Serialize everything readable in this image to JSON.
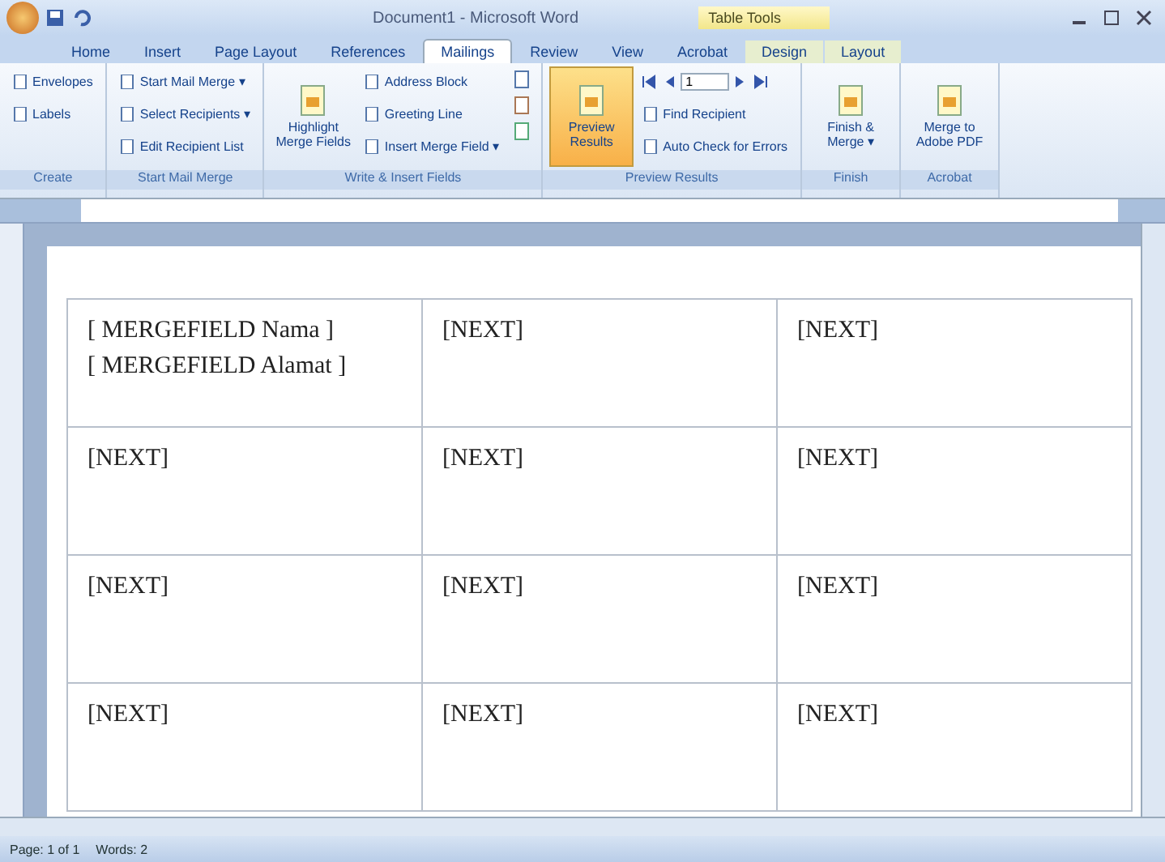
{
  "window": {
    "title": "Document1 - Microsoft Word",
    "contextual_tab": "Table Tools"
  },
  "tabs": [
    {
      "label": "Home",
      "selected": false
    },
    {
      "label": "Insert",
      "selected": false
    },
    {
      "label": "Page Layout",
      "selected": false
    },
    {
      "label": "References",
      "selected": false
    },
    {
      "label": "Mailings",
      "selected": true
    },
    {
      "label": "Review",
      "selected": false
    },
    {
      "label": "View",
      "selected": false
    },
    {
      "label": "Acrobat",
      "selected": false
    },
    {
      "label": "Design",
      "selected": false
    },
    {
      "label": "Layout",
      "selected": false
    }
  ],
  "ribbon": [
    {
      "label": "Create",
      "items": [
        {
          "kind": "small",
          "label": "Envelopes"
        },
        {
          "kind": "small",
          "label": "Labels"
        }
      ]
    },
    {
      "label": "Start Mail Merge",
      "items": [
        {
          "kind": "small",
          "label": "Start Mail Merge ▾"
        },
        {
          "kind": "small",
          "label": "Select Recipients ▾"
        },
        {
          "kind": "small",
          "label": "Edit Recipient List"
        }
      ]
    },
    {
      "label": "Write & Insert Fields",
      "items": [
        {
          "kind": "large",
          "label": "Highlight Merge Fields",
          "on": false
        },
        {
          "kind": "small",
          "label": "Address Block"
        },
        {
          "kind": "small",
          "label": "Greeting Line"
        },
        {
          "kind": "small",
          "label": "Insert Merge Field ▾"
        },
        {
          "kind": "icons"
        }
      ]
    },
    {
      "label": "Preview Results",
      "items": [
        {
          "kind": "large",
          "label": "Preview Results",
          "on": true
        },
        {
          "kind": "nav",
          "label": "1"
        },
        {
          "kind": "small",
          "label": "Find Recipient"
        },
        {
          "kind": "small",
          "label": "Auto Check for Errors"
        }
      ]
    },
    {
      "label": "Finish",
      "items": [
        {
          "kind": "large",
          "label": "Finish & Merge ▾"
        }
      ]
    },
    {
      "label": "Acrobat",
      "items": [
        {
          "kind": "large",
          "label": "Merge to Adobe PDF"
        }
      ]
    }
  ],
  "table": {
    "rows": [
      [
        [
          "[ MERGEFIELD Nama ]",
          "[ MERGEFIELD Alamat ]"
        ],
        [
          "[NEXT]"
        ],
        [
          "[NEXT]"
        ]
      ],
      [
        [
          "[NEXT]"
        ],
        [
          "[NEXT]"
        ],
        [
          "[NEXT]"
        ]
      ],
      [
        [
          "[NEXT]"
        ],
        [
          "[NEXT]"
        ],
        [
          "[NEXT]"
        ]
      ],
      [
        [
          "[NEXT]"
        ],
        [
          "[NEXT]"
        ],
        [
          "[NEXT]"
        ]
      ]
    ]
  },
  "status_bar": {
    "items": [
      "Page: 1 of 1",
      "Words: 2"
    ]
  }
}
